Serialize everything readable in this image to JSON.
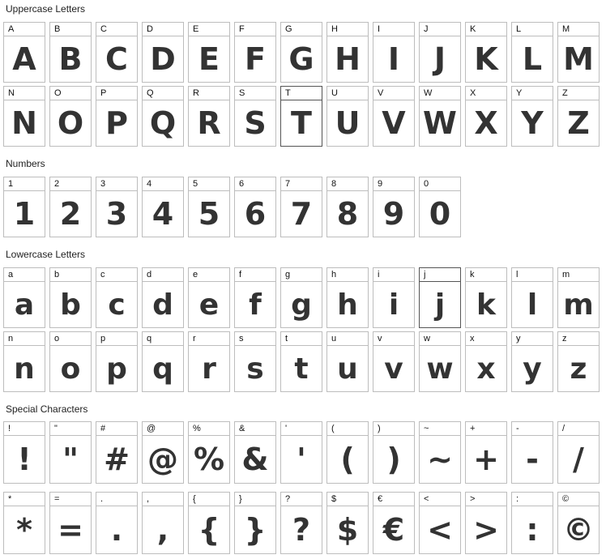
{
  "sections": [
    {
      "title": "Uppercase Letters",
      "rows": [
        [
          "A",
          "B",
          "C",
          "D",
          "E",
          "F",
          "G",
          "H",
          "I",
          "J",
          "K",
          "L",
          "M"
        ],
        [
          "N",
          "O",
          "P",
          "Q",
          "R",
          "S",
          "T",
          "U",
          "V",
          "W",
          "X",
          "Y",
          "Z"
        ]
      ]
    },
    {
      "title": "Numbers",
      "rows": [
        [
          "1",
          "2",
          "3",
          "4",
          "5",
          "6",
          "7",
          "8",
          "9",
          "0"
        ]
      ]
    },
    {
      "title": "Lowercase Letters",
      "rows": [
        [
          "a",
          "b",
          "c",
          "d",
          "e",
          "f",
          "g",
          "h",
          "i",
          "j",
          "k",
          "l",
          "m"
        ],
        [
          "n",
          "o",
          "p",
          "q",
          "r",
          "s",
          "t",
          "u",
          "v",
          "w",
          "x",
          "y",
          "z"
        ]
      ]
    },
    {
      "title": "Special Characters",
      "rows": [
        [
          "!",
          "\"",
          "#",
          "@",
          "%",
          "&",
          "'",
          "(",
          ")",
          "~",
          "+",
          "-",
          "/"
        ],
        [
          "*",
          "=",
          ".",
          ",",
          "{",
          "}",
          "?",
          "$",
          "€",
          "<",
          ">",
          ":",
          "©"
        ]
      ]
    }
  ],
  "selected_cells": [
    "T",
    "j"
  ]
}
